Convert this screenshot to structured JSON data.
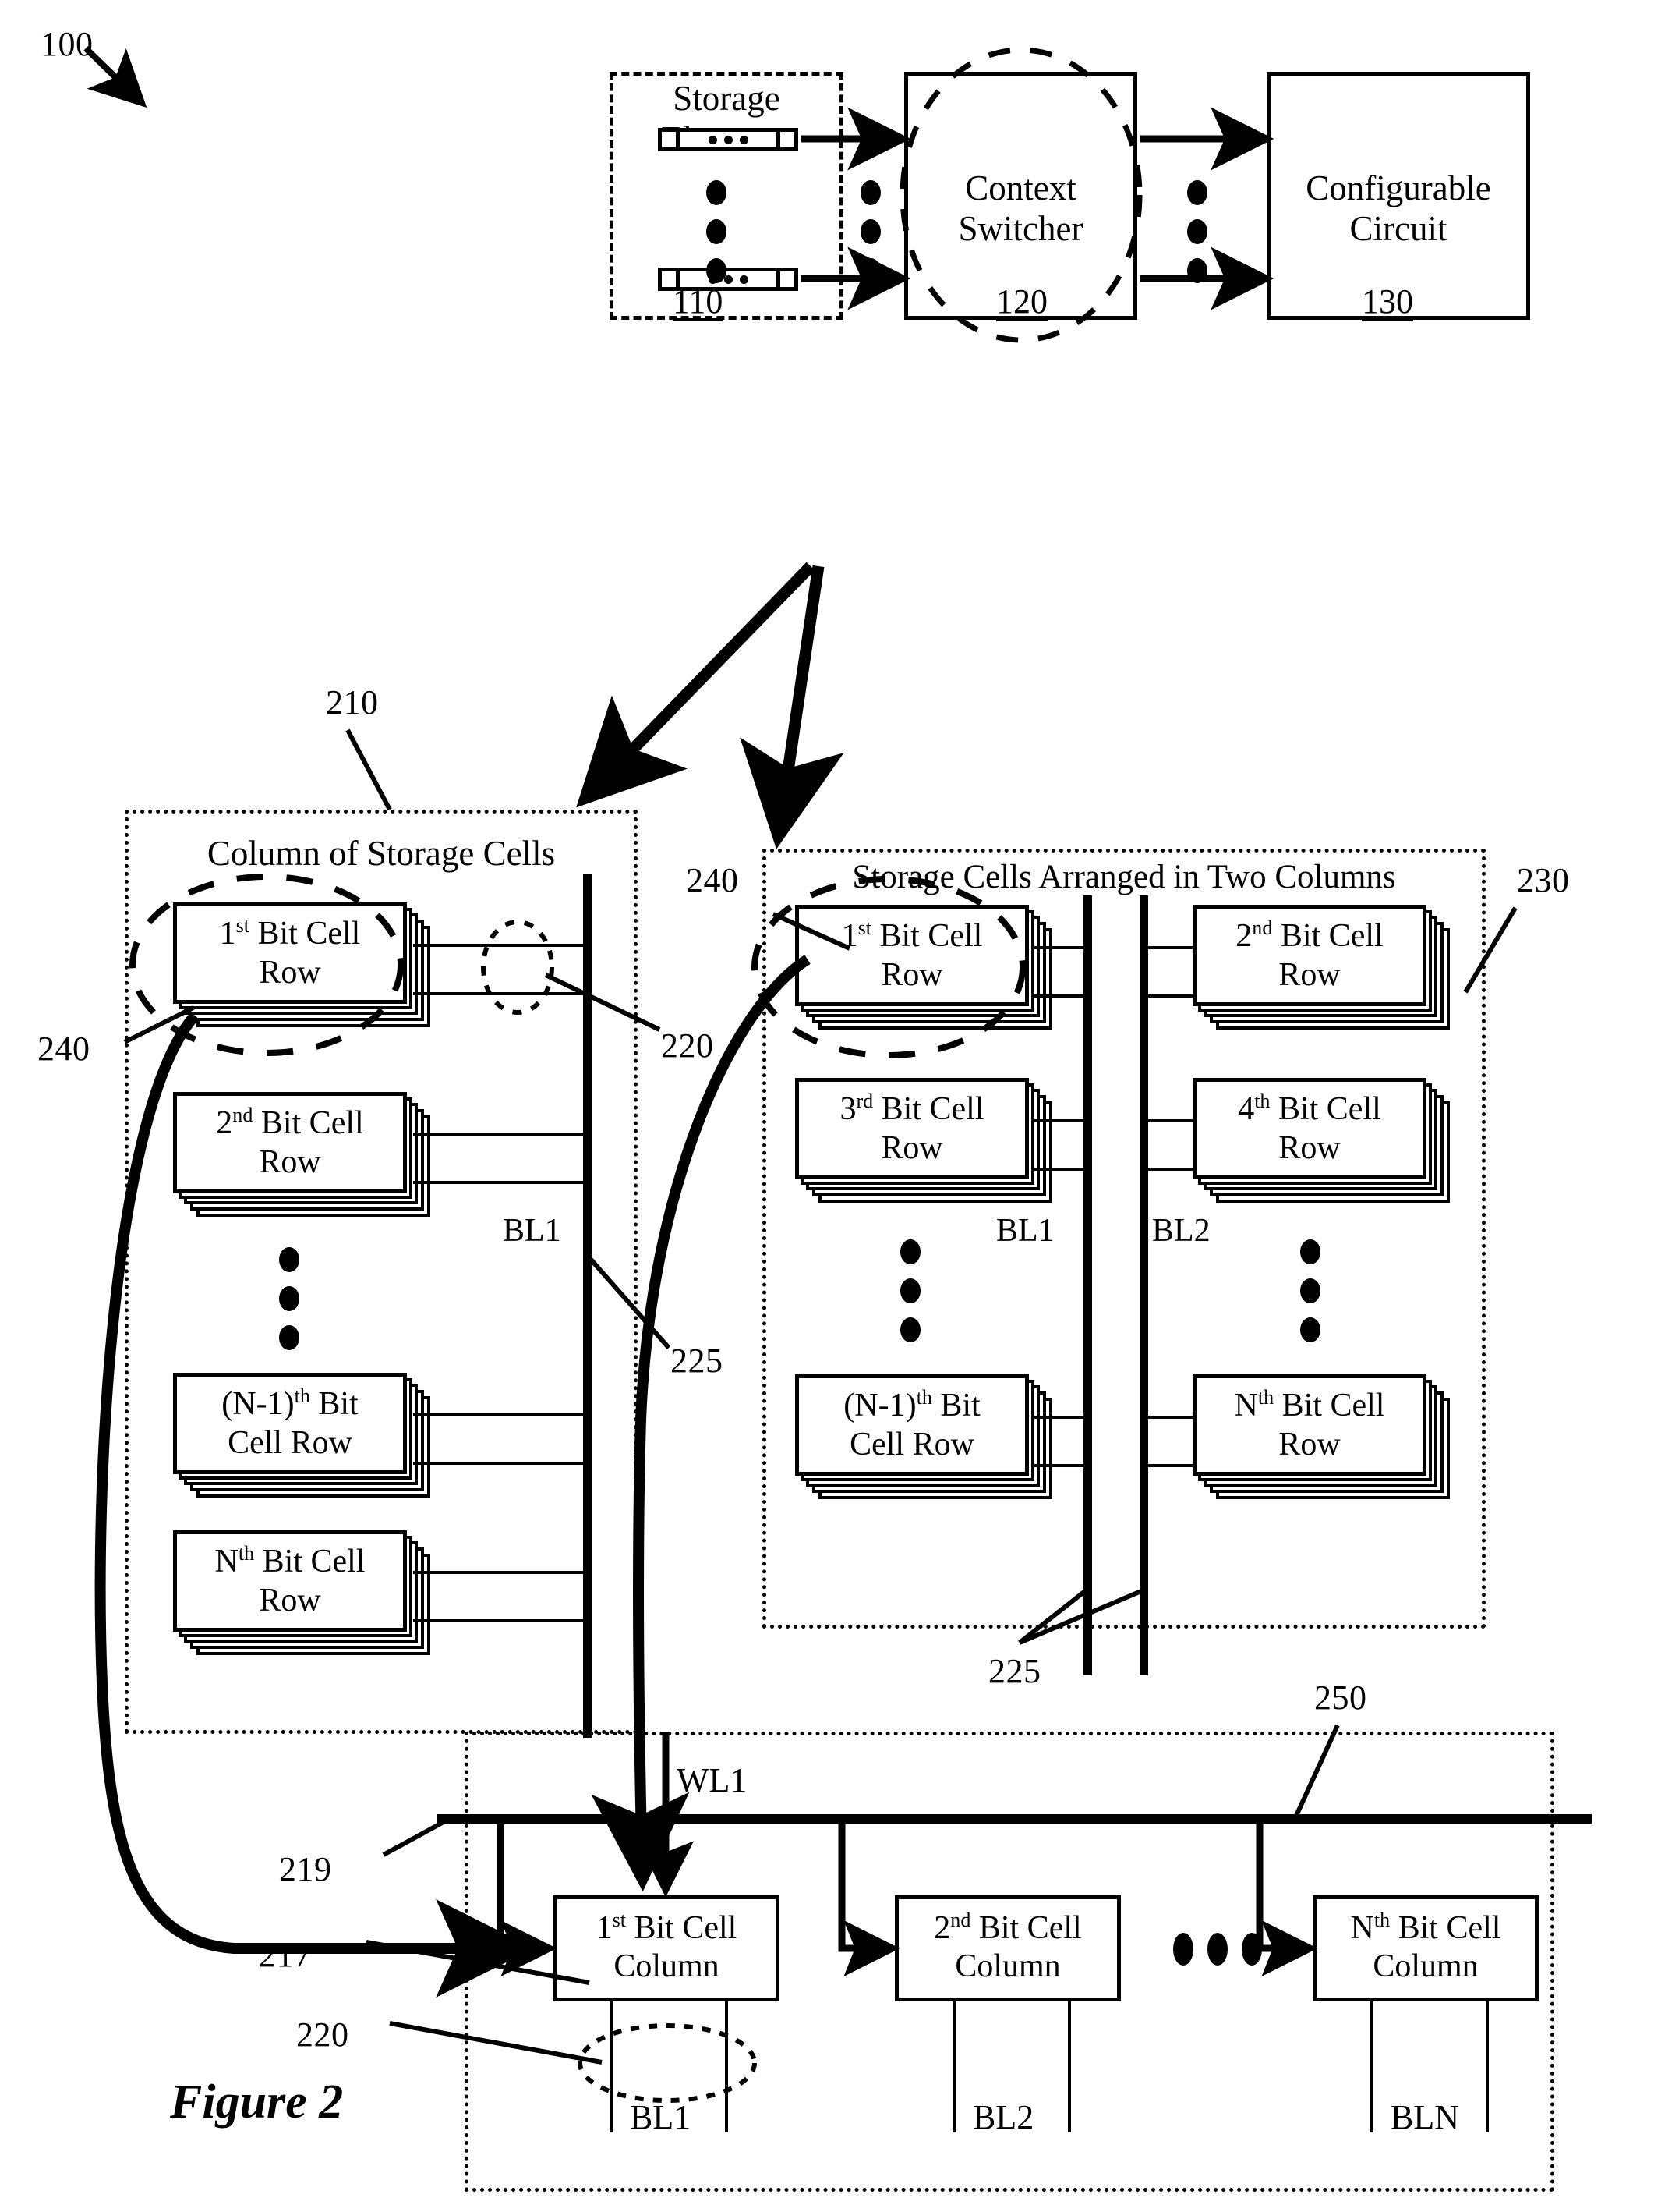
{
  "figure": {
    "caption": "Figure 2",
    "system_ref": "100"
  },
  "top_blocks": {
    "storage_elements": {
      "label_line1": "Storage",
      "label_line2": "Elements",
      "ref": "110"
    },
    "context_switcher": {
      "label_line1": "Context",
      "label_line2": "Switcher",
      "ref": "120"
    },
    "configurable_circuit": {
      "label_line1": "Configurable",
      "label_line2": "Circuit",
      "ref": "130"
    }
  },
  "single_column_block": {
    "ref": "210",
    "title": "Column of Storage Cells",
    "bitline_label": "BL1",
    "rows": [
      {
        "line1": "1",
        "sup1": "st",
        "rest1": " Bit Cell",
        "line2": "Row"
      },
      {
        "line1": "2",
        "sup1": "nd",
        "rest1": " Bit Cell",
        "line2": "Row"
      },
      {
        "line1": "(N-1)",
        "sup1": "th",
        "rest1": " Bit",
        "line2": "Cell Row"
      },
      {
        "line1": "N",
        "sup1": "th",
        "rest1": " Bit Cell",
        "line2": "Row"
      }
    ],
    "callouts": {
      "cell_group": "240",
      "bitline_connection": "220",
      "bitline": "225"
    }
  },
  "two_column_block": {
    "ref": "230",
    "title": "Storage Cells Arranged in Two Columns",
    "bitline_label_left": "BL1",
    "bitline_label_right": "BL2",
    "left_rows": [
      {
        "line1": "1",
        "sup1": "st",
        "rest1": " Bit Cell",
        "line2": "Row"
      },
      {
        "line1": "3",
        "sup1": "rd",
        "rest1": " Bit Cell",
        "line2": "Row"
      },
      {
        "line1": "(N-1)",
        "sup1": "th",
        "rest1": " Bit",
        "line2": "Cell Row"
      }
    ],
    "right_rows": [
      {
        "line1": "2",
        "sup1": "nd",
        "rest1": " Bit Cell",
        "line2": "Row"
      },
      {
        "line1": "4",
        "sup1": "th",
        "rest1": " Bit Cell",
        "line2": "Row"
      },
      {
        "line1": "N",
        "sup1": "th",
        "rest1": " Bit Cell",
        "line2": "Row"
      }
    ],
    "callouts": {
      "cell_group": "240",
      "bitlines": "225"
    }
  },
  "bit_cell_column_block": {
    "ref": "250",
    "wordline_label": "WL1",
    "columns": [
      {
        "line1": "1",
        "sup1": "st",
        "rest1": " Bit Cell",
        "line2": "Column",
        "bitline": "BL1"
      },
      {
        "line1": "2",
        "sup1": "nd",
        "rest1": " Bit Cell",
        "line2": "Column",
        "bitline": "BL2"
      },
      {
        "line1": "N",
        "sup1": "th",
        "rest1": " Bit Cell",
        "line2": "Column",
        "bitline": "BLN"
      }
    ],
    "callouts": {
      "wordline": "219",
      "column_input": "217",
      "bitline_pair": "220"
    }
  },
  "colors": {
    "ink": "#000000",
    "paper": "#ffffff"
  }
}
